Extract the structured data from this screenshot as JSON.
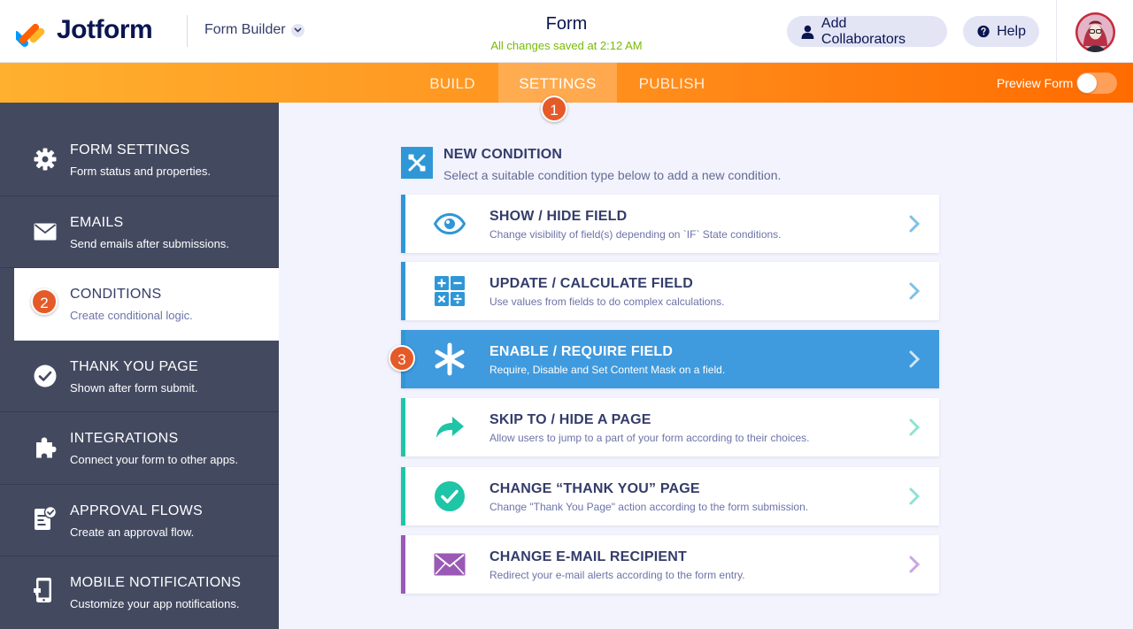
{
  "header": {
    "brand": "Jotform",
    "builder_menu": "Form Builder",
    "form_title": "Form",
    "save_status": "All changes saved at 2:12 AM",
    "add_collaborators": "Add Collaborators",
    "help": "Help"
  },
  "nav": {
    "tabs": [
      "BUILD",
      "SETTINGS",
      "PUBLISH"
    ],
    "active_tab": "SETTINGS",
    "preview_label": "Preview Form",
    "preview_enabled": false
  },
  "badges": [
    "1",
    "2",
    "3"
  ],
  "sidebar": {
    "items": [
      {
        "title": "FORM SETTINGS",
        "subtitle": "Form status and properties.",
        "icon": "gear-icon"
      },
      {
        "title": "EMAILS",
        "subtitle": "Send emails after submissions.",
        "icon": "envelope-icon"
      },
      {
        "title": "CONDITIONS",
        "subtitle": "Create conditional logic.",
        "icon": "none",
        "active": true
      },
      {
        "title": "THANK YOU PAGE",
        "subtitle": "Shown after form submit.",
        "icon": "check-circle-icon"
      },
      {
        "title": "INTEGRATIONS",
        "subtitle": "Connect your form to other apps.",
        "icon": "puzzle-icon"
      },
      {
        "title": "APPROVAL FLOWS",
        "subtitle": "Create an approval flow.",
        "icon": "approval-icon"
      },
      {
        "title": "MOBILE NOTIFICATIONS",
        "subtitle": "Customize your app notifications.",
        "icon": "mobile-icon"
      }
    ]
  },
  "main": {
    "title": "NEW CONDITION",
    "subtitle": "Select a suitable condition type below to add a new condition.",
    "conditions": [
      {
        "title": "SHOW / HIDE FIELD",
        "subtitle": "Change visibility of field(s) depending on `IF` State conditions.",
        "icon": "eye-icon",
        "color": "#3097d6"
      },
      {
        "title": "UPDATE / CALCULATE FIELD",
        "subtitle": "Use values from fields to do complex calculations.",
        "icon": "calculator-icon",
        "color": "#3097d6"
      },
      {
        "title": "ENABLE / REQUIRE FIELD",
        "subtitle": "Require, Disable and Set Content Mask on a field.",
        "icon": "asterisk-icon",
        "color": "#3097d6",
        "selected": true
      },
      {
        "title": "SKIP TO / HIDE A PAGE",
        "subtitle": "Allow users to jump to a part of your form according to their choices.",
        "icon": "skip-arrow-icon",
        "color": "#1ec5a6"
      },
      {
        "title": "CHANGE “THANK YOU” PAGE",
        "subtitle": "Change \"Thank You Page\" action according to the form submission.",
        "icon": "check-circle-icon",
        "color": "#1ec5a6"
      },
      {
        "title": "CHANGE E-MAIL RECIPIENT",
        "subtitle": "Redirect your e-mail alerts according to the form entry.",
        "icon": "envelope-icon",
        "color": "#9b59b6"
      }
    ]
  },
  "colors": {
    "accent_orange": "#ff6b00",
    "sidebar_bg": "#434a60",
    "selected_card": "#3f9ade",
    "badge": "#e55a29",
    "saved_green": "#78bb07"
  }
}
